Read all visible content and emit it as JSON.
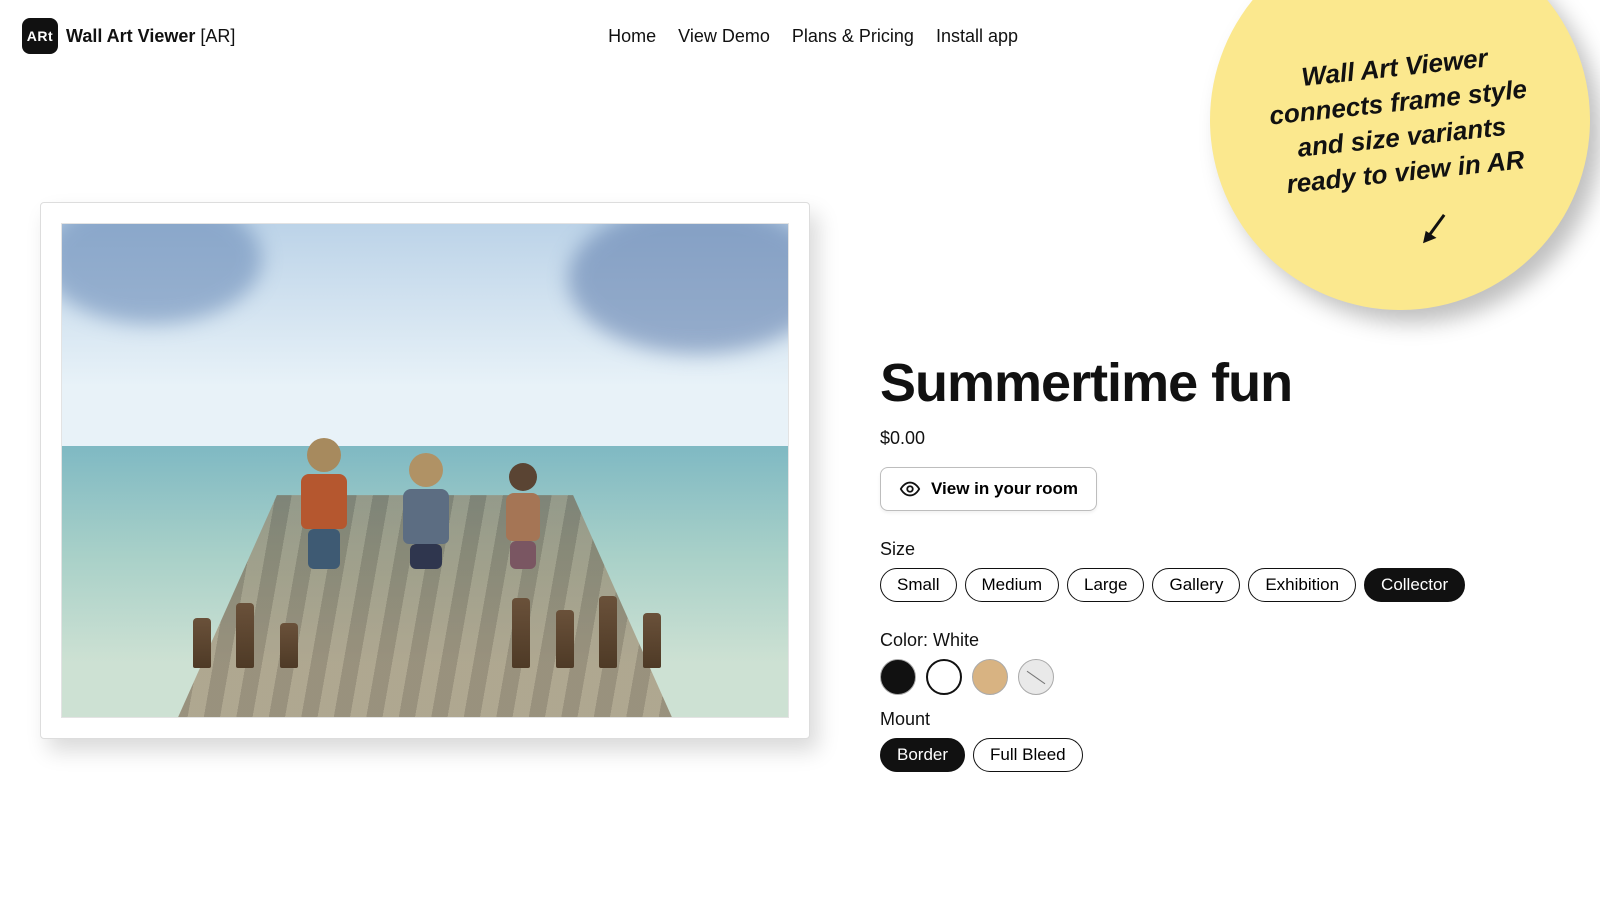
{
  "brand": {
    "logo_text": "ARt",
    "name_main": "Wall Art Viewer",
    "name_suffix": "[AR]"
  },
  "nav": {
    "home": "Home",
    "demo": "View Demo",
    "plans": "Plans & Pricing",
    "install": "Install app"
  },
  "bubble": {
    "text": "Wall Art Viewer connects frame style and size variants ready to view in AR"
  },
  "product": {
    "title": "Summertime fun",
    "price": "$0.00",
    "view_button": "View in your room",
    "size_label": "Size",
    "sizes": {
      "small": "Small",
      "medium": "Medium",
      "large": "Large",
      "gallery": "Gallery",
      "exhibition": "Exhibition",
      "collector": "Collector"
    },
    "color_label": "Color: White",
    "mount_label": "Mount",
    "mounts": {
      "border": "Border",
      "full_bleed": "Full Bleed"
    }
  }
}
